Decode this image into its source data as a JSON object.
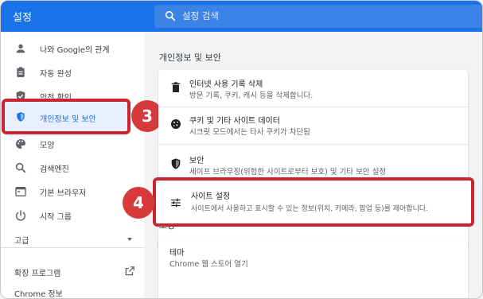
{
  "app": {
    "title": "설정"
  },
  "search": {
    "placeholder": "설정 검색"
  },
  "sidebar": {
    "items": [
      {
        "label": "나와 Google의 관계",
        "icon": "person-icon"
      },
      {
        "label": "자동 완성",
        "icon": "clipboard-icon"
      },
      {
        "label": "안전 확인",
        "icon": "shield-check-icon"
      },
      {
        "label": "개인정보 및 보안",
        "icon": "shield-icon",
        "selected": true
      },
      {
        "label": "모양",
        "icon": "palette-icon"
      },
      {
        "label": "검색엔진",
        "icon": "search-icon"
      },
      {
        "label": "기본 브라우저",
        "icon": "browser-icon"
      },
      {
        "label": "시작 그룹",
        "icon": "power-icon"
      }
    ],
    "advanced": "고급",
    "extensions": "확장 프로그램",
    "about": "Chrome 정보"
  },
  "main": {
    "privacy_title": "개인정보 및 보안",
    "rows": [
      {
        "title": "인터넷 사용 기록 삭제",
        "desc": "방문 기록, 쿠키, 캐시 등을 삭제합니다.",
        "icon": "trash-icon"
      },
      {
        "title": "쿠키 및 기타 사이트 데이터",
        "desc": "시크릿 모드에서는 타사 쿠키가 차단됨",
        "icon": "cookie-icon"
      },
      {
        "title": "보안",
        "desc": "세이프 브라우징(위험한 사이트로부터 보호) 및 기타 보안 설정",
        "icon": "shield-icon"
      },
      {
        "title": "사이트 설정",
        "desc": "사이트에서 사용하고 표시할 수 있는 정보(위치, 카메라, 팝업 등)를 제어합니다.",
        "icon": "sliders-icon"
      }
    ],
    "appearance_title": "모양",
    "theme": {
      "title": "테마",
      "desc": "Chrome 웹 스토어 열기"
    }
  },
  "annotations": {
    "step3": "3",
    "step4": "4"
  },
  "colors": {
    "brand": "#1a73e8",
    "annotation": "#c9242f"
  }
}
